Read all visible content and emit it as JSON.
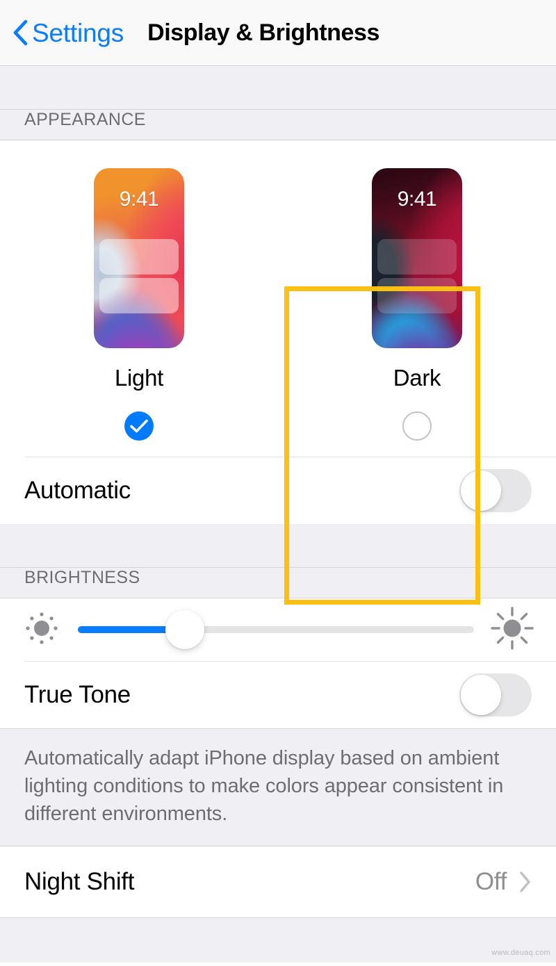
{
  "navbar": {
    "back_label": "Settings",
    "back_icon": "chevron-left-icon",
    "title": "Display & Brightness"
  },
  "appearance": {
    "section_header": "APPEARANCE",
    "options": [
      {
        "label": "Light",
        "preview_time": "9:41",
        "selected": true,
        "radio_icon": "checkmark-circle-icon"
      },
      {
        "label": "Dark",
        "preview_time": "9:41",
        "selected": false,
        "radio_icon": "empty-circle-icon"
      }
    ],
    "highlight_color": "#fcc015",
    "automatic": {
      "label": "Automatic",
      "toggle_state": "off"
    }
  },
  "brightness": {
    "section_header": "BRIGHTNESS",
    "slider": {
      "low_icon": "brightness-low-icon",
      "high_icon": "brightness-high-icon",
      "value_percent": 27
    },
    "true_tone": {
      "label": "True Tone",
      "toggle_state": "off"
    },
    "footer_note": "Automatically adapt iPhone display based on ambient lighting conditions to make colors appear consistent in different environments."
  },
  "night_shift": {
    "label": "Night Shift",
    "value": "Off",
    "chevron_icon": "chevron-right-icon"
  },
  "watermark": "www.deuaq.com",
  "colors": {
    "accent_blue": "#007aff",
    "link_blue": "#0a7cff",
    "group_background": "#efeff4",
    "secondary_text": "#6d6d72",
    "value_text": "#8e8e93",
    "highlight_yellow": "#fcc015"
  }
}
